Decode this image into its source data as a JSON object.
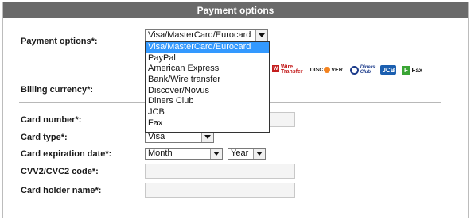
{
  "header": {
    "title": "Payment options"
  },
  "payment": {
    "label": "Payment options*:",
    "selected": "Visa/MasterCard/Eurocard",
    "options": [
      "Visa/MasterCard/Eurocard",
      "PayPal",
      "American Express",
      "Bank/Wire transfer",
      "Discover/Novus",
      "Diners Club",
      "JCB",
      "Fax"
    ]
  },
  "logos": {
    "wire_line1": "Wire",
    "wire_line2": "Transfer",
    "wire_icon": "W",
    "discover_prefix": "DISC",
    "discover_suffix": "VER",
    "diners_line1": "Diners",
    "diners_line2": "Club",
    "jcb": "JCB",
    "fax_icon": "F",
    "fax": "Fax"
  },
  "billing": {
    "label": "Billing currency*:"
  },
  "card_number": {
    "label": "Card number*:"
  },
  "card_type": {
    "label": "Card type*:",
    "selected": "Visa"
  },
  "expiration": {
    "label": "Card expiration date*:",
    "month": "Month",
    "year": "Year"
  },
  "cvv": {
    "label": "CVV2/CVC2 code*:"
  },
  "holder": {
    "label": "Card holder name*:"
  }
}
